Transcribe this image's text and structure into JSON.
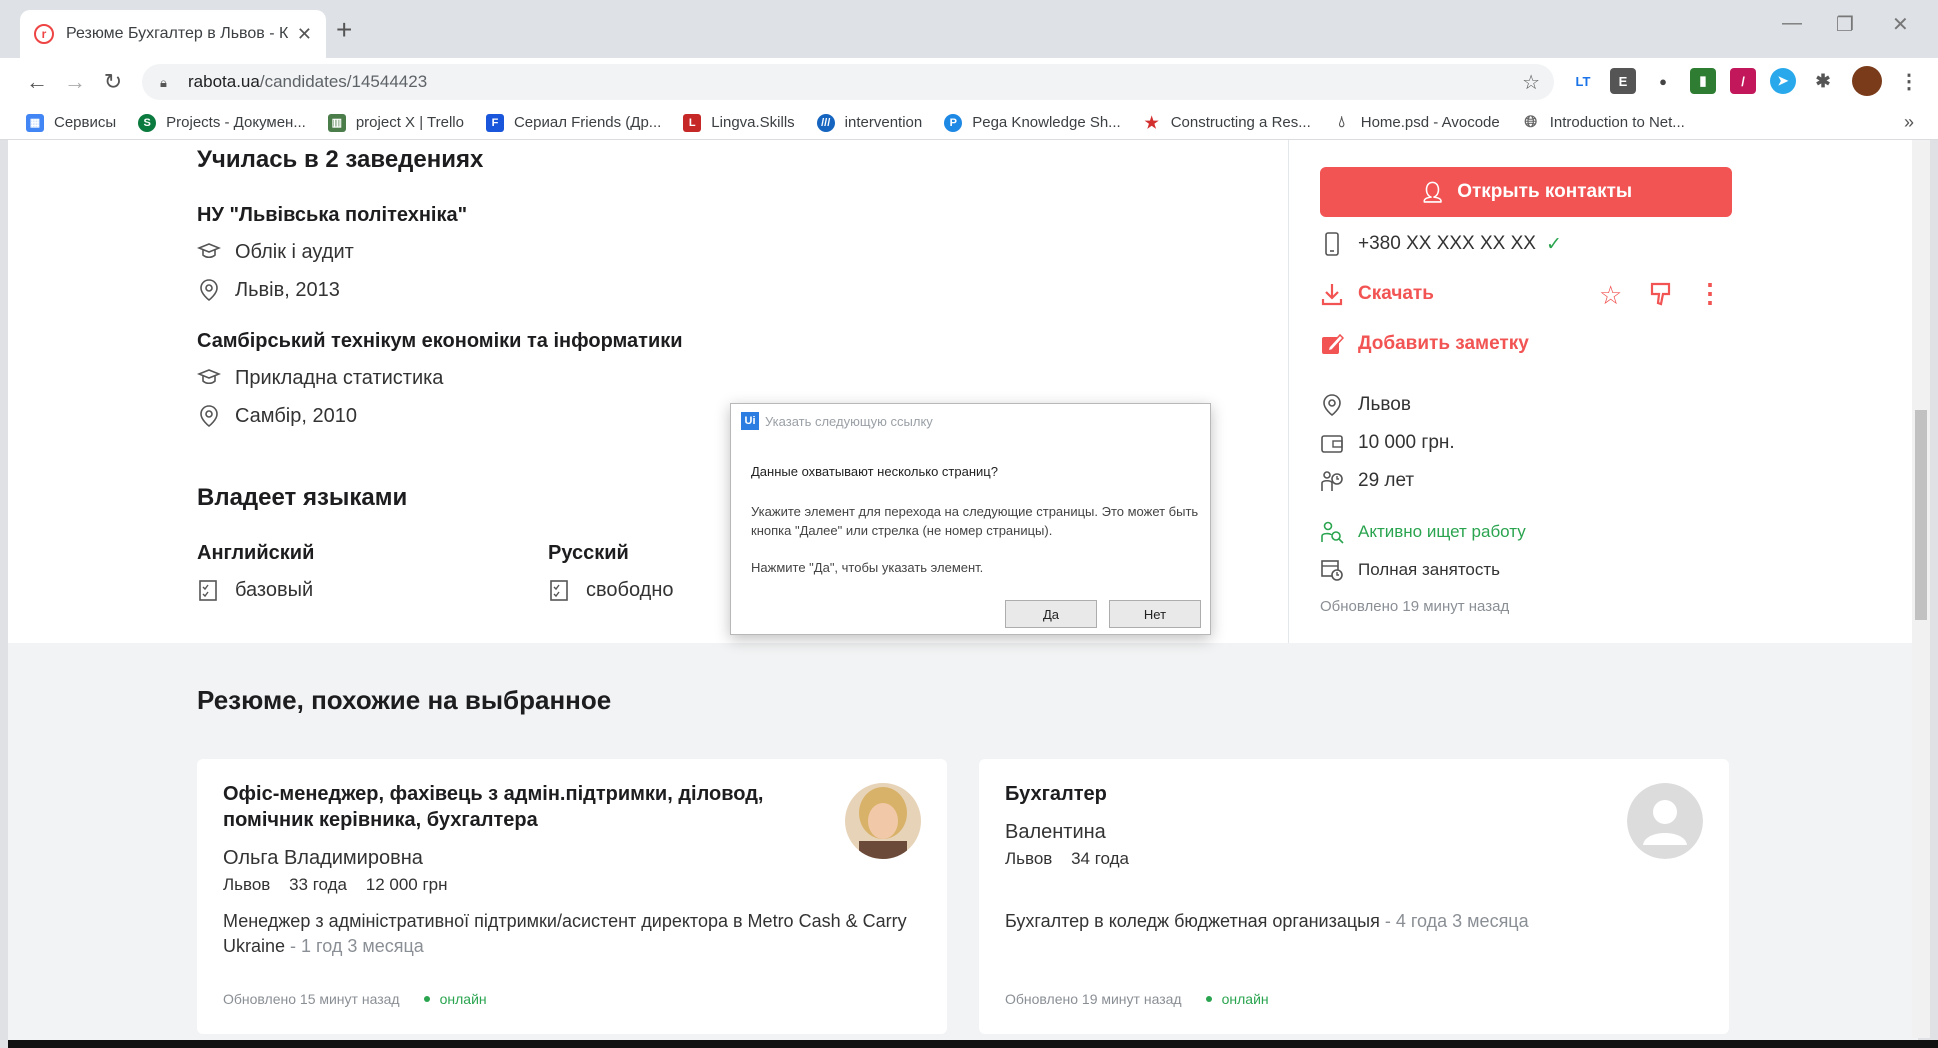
{
  "browser": {
    "tab_title": "Резюме Бухгалтер в Львов - Ка",
    "url_host": "rabota.ua",
    "url_path": "/candidates/14544423",
    "bookmarks": [
      {
        "label": "Сервисы",
        "color": "#4285f4"
      },
      {
        "label": "Projects - Докумен...",
        "color": "#0b7a3e"
      },
      {
        "label": "project X | Trello",
        "color": "#4a7d4a"
      },
      {
        "label": "Сериал Friends (Др...",
        "color": "#1a56db"
      },
      {
        "label": "Lingva.Skills",
        "color": "#c62828"
      },
      {
        "label": "intervention",
        "color": "#1565c0"
      },
      {
        "label": "Pega Knowledge Sh...",
        "color": "#1e88e5"
      },
      {
        "label": "Constructing a Res...",
        "color": "#d32f2f"
      },
      {
        "label": "Home.psd - Avocode",
        "color": "#555555"
      },
      {
        "label": "Introduction to Net...",
        "color": "#666666"
      }
    ]
  },
  "education": {
    "heading": "Училась в 2 заведениях",
    "items": [
      {
        "institution": "НУ \"Львівська політехніка\"",
        "specialty": "Облік і аудит",
        "place": "Львів, 2013"
      },
      {
        "institution": "Самбірський технікум економіки та інформатики",
        "specialty": "Прикладна статистика",
        "place": "Самбір, 2010"
      }
    ]
  },
  "languages": {
    "heading": "Владеет языками",
    "items": [
      {
        "name": "Английский",
        "level": "базовый"
      },
      {
        "name": "Русский",
        "level": "свободно"
      }
    ]
  },
  "sidebar": {
    "open_contacts": "Открыть контакты",
    "phone": "+380 XX XXX XX XX",
    "download": "Скачать",
    "add_note": "Добавить заметку",
    "city": "Львов",
    "salary": "10 000 грн.",
    "age": "29 лет",
    "status": "Активно ищет работу",
    "employment": "Полная занятость",
    "updated": "Обновлено 19 минут назад"
  },
  "similar": {
    "heading": "Резюме, похожие на выбранное",
    "cards": [
      {
        "title": "Офіс-менеджер, фахівець з адмін.підтримки, діловод, помічник керівника, бухгалтера",
        "name": "Ольга Владимировна",
        "city": "Львов",
        "age": "33 года",
        "salary": "12 000 грн",
        "experience": "Менеджер з адміністративної підтримки/асистент директора в Metro Cash & Carry Ukraine",
        "duration": " - 1 год 3 месяца",
        "updated": "Обновлено 15 минут назад",
        "online": "онлайн"
      },
      {
        "title": "Бухгалтер",
        "name": "Валентина",
        "city": "Львов",
        "age": "34 года",
        "salary": "",
        "experience": "Бухгалтер в коледж бюджетная организацыя",
        "duration": " - 4 года 3 месяца",
        "updated": "Обновлено 19 минут назад",
        "online": "онлайн"
      }
    ]
  },
  "dialog": {
    "title": "Указать следующую ссылку",
    "question": "Данные охватывают несколько страниц?",
    "body": "Укажите элемент для перехода на следующие страницы. Это может быть кнопка \"Далее\" или стрелка (не номер страницы).",
    "hint": "Нажмите \"Да\", чтобы указать элемент.",
    "yes": "Да",
    "no": "Нет"
  }
}
